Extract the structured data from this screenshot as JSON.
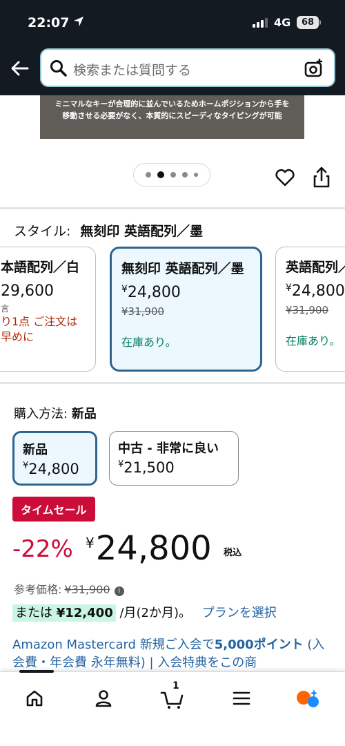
{
  "status": {
    "time": "22:07",
    "network": "4G",
    "battery": "68"
  },
  "search": {
    "placeholder": "検索または質問する"
  },
  "banner": {
    "line1": "ミニマルなキーが合理的に並んでいるためホームポジションから手を",
    "line2": "移動させる必要がなく、本質的にスピーディなタイピングが可能"
  },
  "carousel": {
    "count": 5,
    "active_index": 1
  },
  "style": {
    "label": "スタイル:",
    "selected": "無刻印 英語配列／墨",
    "options": [
      {
        "name": "本語配列／白",
        "price": "29,600",
        "availability_line1": "り1点 ご注文は",
        "availability_line2": "早めに",
        "small": "言"
      },
      {
        "name": "無刻印 英語配列／墨",
        "currency": "¥",
        "price": "24,800",
        "list_price": "¥31,900",
        "availability": "在庫あり。"
      },
      {
        "name": "英語配列／",
        "currency": "¥",
        "price": "24,800",
        "list_price": "¥31,900",
        "availability": "在庫あり。"
      }
    ]
  },
  "purchase": {
    "label": "購入方法:",
    "selected": "新品",
    "options": [
      {
        "name": "新品",
        "currency": "¥",
        "price": "24,800"
      },
      {
        "name": "中古 - 非常に良い",
        "currency": "¥",
        "price": "21,500"
      }
    ]
  },
  "deal": {
    "badge": "タイムセール",
    "discount": "-22%",
    "currency": "¥",
    "price": "24,800",
    "tax": "税込",
    "reference_label": "参考価格:",
    "reference_price": "¥31,900",
    "installment_prefix": "または",
    "installment_amount": "¥12,400",
    "installment_suffix": "/月(2か月)。",
    "plan_link": "プランを選択"
  },
  "promo": {
    "part1": "Amazon Mastercard 新規ご入会で",
    "bold": "5,000ポイント",
    "part2": " (入会費・年会費 永年無料) | 入会特典をこの商"
  },
  "bottom_nav": {
    "cart_count": "1",
    "items": [
      "home-icon",
      "account-icon",
      "cart-icon",
      "menu-icon",
      "rufus-icon"
    ]
  },
  "colors": {
    "header": "#131a22",
    "selected_border": "#2e6490",
    "deal_red": "#cc0c39",
    "link": "#2162a1",
    "in_stock": "#067d62"
  }
}
